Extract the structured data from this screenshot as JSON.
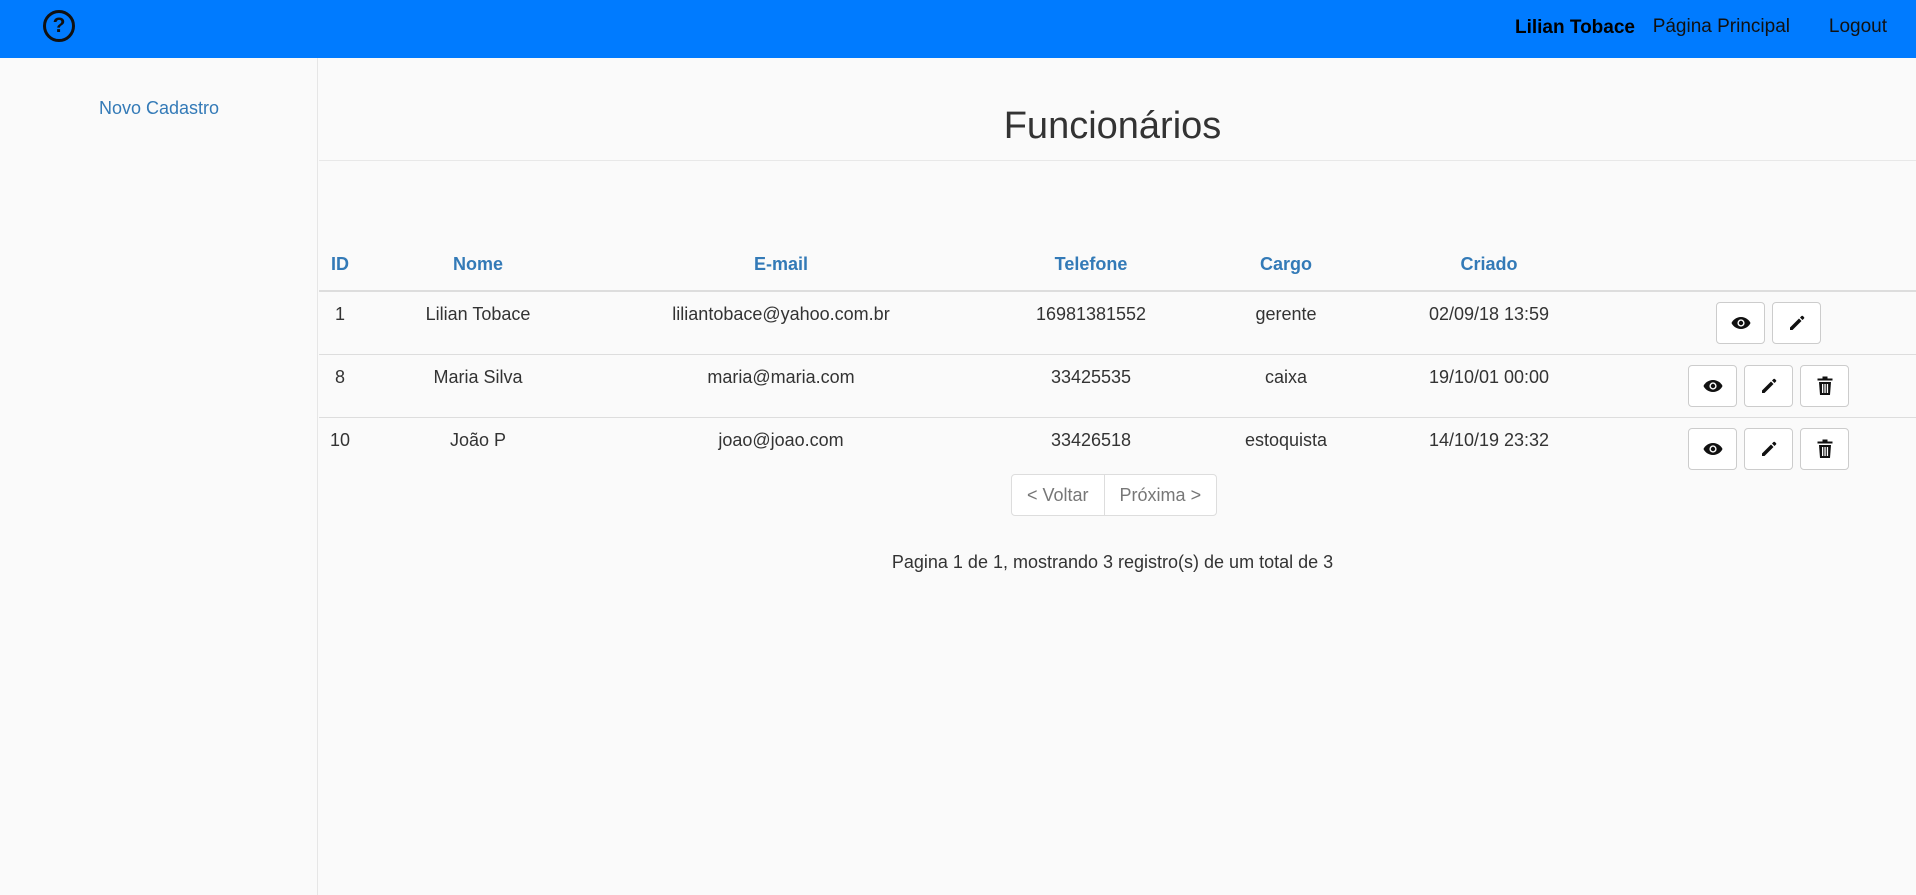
{
  "nav": {
    "user": "Lilian Tobace",
    "home": "Página Principal",
    "logout": "Logout",
    "help_icon": "question-circle-icon",
    "help_glyph": "?",
    "brand_color": "#007bff"
  },
  "sidebar": {
    "new_link": "Novo Cadastro"
  },
  "main": {
    "title": "Funcionários",
    "columns": [
      "ID",
      "Nome",
      "E-mail",
      "Telefone",
      "Cargo",
      "Criado"
    ],
    "rows": [
      {
        "id": "1",
        "name": "Lilian Tobace",
        "email": "liliantobace@yahoo.com.br",
        "phone": "16981381552",
        "role": "gerente",
        "created": "02/09/18 13:59",
        "can_delete": false
      },
      {
        "id": "8",
        "name": "Maria Silva",
        "email": "maria@maria.com",
        "phone": "33425535",
        "role": "caixa",
        "created": "19/10/01 00:00",
        "can_delete": true
      },
      {
        "id": "10",
        "name": "João P",
        "email": "joao@joao.com",
        "phone": "33426518",
        "role": "estoquista",
        "created": "14/10/19 23:32",
        "can_delete": true
      }
    ],
    "row_icons": [
      "eye-icon",
      "pencil-icon",
      "trash-icon"
    ]
  },
  "pagination": {
    "prev": "< Voltar",
    "next": "Próxima >",
    "info": "Pagina 1 de 1, mostrando 3 registro(s) de um total de 3"
  },
  "colors": {
    "link": "#337ab7",
    "header_bar": "#007bff"
  }
}
